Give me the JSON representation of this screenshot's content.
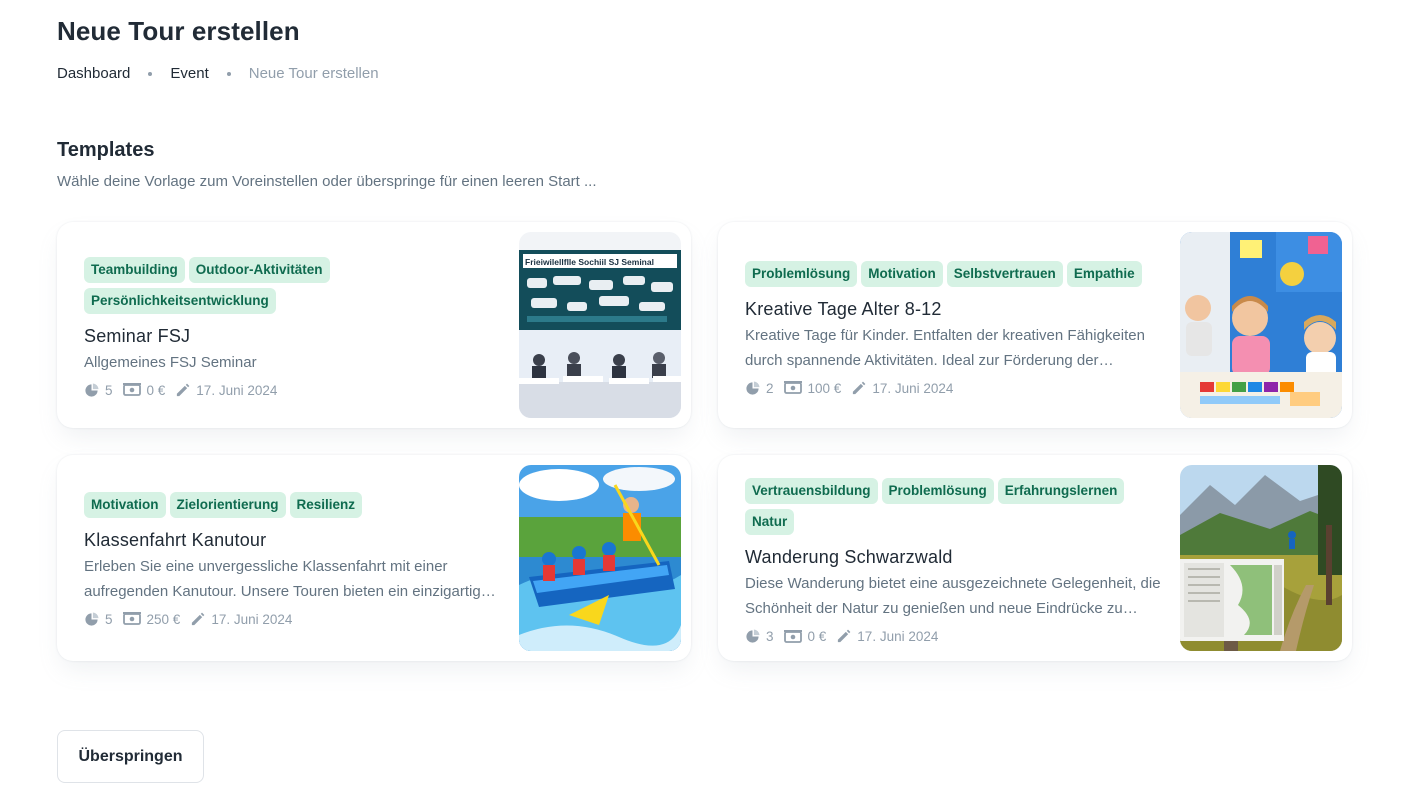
{
  "header": {
    "title": "Neue Tour erstellen",
    "breadcrumb": [
      "Dashboard",
      "Event",
      "Neue Tour erstellen"
    ]
  },
  "templates": {
    "title": "Templates",
    "subtitle": "Wähle deine Vorlage zum Voreinstellen oder überspringe für einen leeren Start ...",
    "cards": [
      {
        "tags": [
          "Teambuilding",
          "Outdoor-Aktivitäten",
          "Persönlichkeitsentwicklung"
        ],
        "title": "Seminar FSJ",
        "description": "Allgemeines FSJ Seminar",
        "duration": "5",
        "price": "0 €",
        "date": "17. Juni 2024",
        "image_text": "Frieiwilellflle Sochiil SJ Seminal"
      },
      {
        "tags": [
          "Problemlösung",
          "Motivation",
          "Selbstvertrauen",
          "Empathie"
        ],
        "title": "Kreative Tage Alter 8-12",
        "description": "Kreative Tage für Kinder. Entfalten der kreativen Fähigkeiten durch spannende Aktivitäten. Ideal zur Förderung der Kreativität.",
        "duration": "2",
        "price": "100 €",
        "date": "17. Juni 2024"
      },
      {
        "tags": [
          "Motivation",
          "Zielorientierung",
          "Resilienz"
        ],
        "title": "Klassenfahrt Kanutour",
        "description": "Erleben Sie eine unvergessliche Klassenfahrt mit einer aufregenden Kanutour. Unsere Touren bieten ein einzigartiges Erlebnis.",
        "duration": "5",
        "price": "250 €",
        "date": "17. Juni 2024"
      },
      {
        "tags": [
          "Vertrauensbildung",
          "Problemlösung",
          "Erfahrungslernen",
          "Natur"
        ],
        "title": "Wanderung Schwarzwald",
        "description": "Diese Wanderung bietet eine ausgezeichnete Gelegenheit, die Schönheit der Natur zu genießen und neue Eindrücke zu sammeln.",
        "duration": "3",
        "price": "0 €",
        "date": "17. Juni 2024"
      }
    ]
  },
  "actions": {
    "skip_label": "Überspringen"
  },
  "colors": {
    "tag_bg": "#d6f2e4",
    "tag_text": "#0f6b4f",
    "text_primary": "#212b36",
    "text_secondary": "#637381",
    "text_muted": "#919eab"
  },
  "icons": {
    "duration": "pie-icon",
    "price": "money-icon",
    "date": "pencil-icon"
  }
}
